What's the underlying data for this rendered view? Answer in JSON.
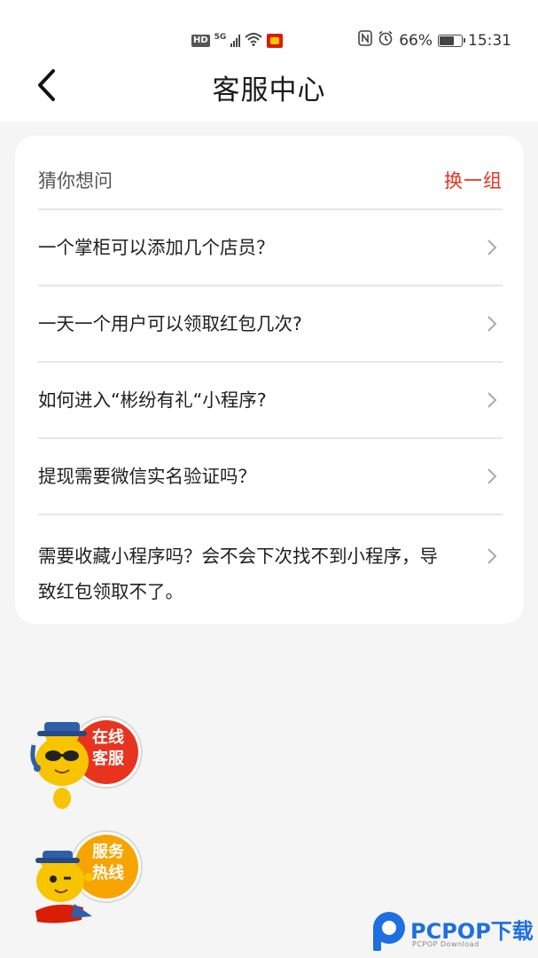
{
  "status_bar": {
    "hd": "HD",
    "network": "5G",
    "battery_percent": "66%",
    "battery_level": 0.66,
    "time": "15:31",
    "icons": [
      "hd-icon",
      "signal-icon",
      "wifi-icon",
      "app-notification-icon",
      "nfc-icon",
      "alarm-icon",
      "battery-icon"
    ]
  },
  "header": {
    "back_icon": "chevron-left-icon",
    "title": "客服中心"
  },
  "guess": {
    "title": "猜你想问",
    "refresh_label": "换一组",
    "accent_color": "#e8341f",
    "questions": [
      "一个掌柜可以添加几个店员？",
      "一天一个用户可以领取红包几次?",
      "如何进入“彬纷有礼“小程序?",
      "提现需要微信实名验证吗？",
      "需要收藏小程序吗？会不会下次找不到小程序，导致红包领取不了。"
    ]
  },
  "floating": {
    "online_service": {
      "line1": "在线",
      "line2": "客服",
      "color": "#e8341f"
    },
    "hotline": {
      "line1": "服务",
      "line2": "热线",
      "color": "#f7a400"
    }
  },
  "watermark": {
    "brand": "PCPOP下载",
    "sub": "PCPOP Download"
  }
}
